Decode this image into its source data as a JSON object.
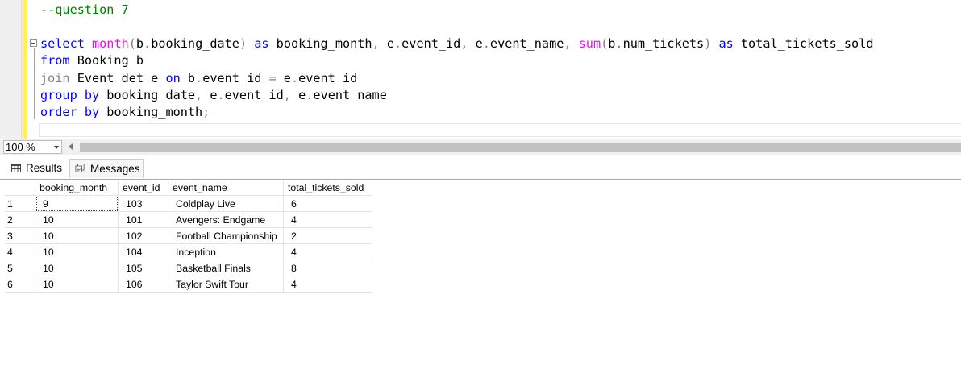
{
  "editor": {
    "lines": [
      [
        {
          "t": "--question 7",
          "c": "cm"
        }
      ],
      [],
      [
        {
          "t": "select ",
          "c": "kw"
        },
        {
          "t": "month",
          "c": "fn"
        },
        {
          "t": "(",
          "c": "op"
        },
        {
          "t": "b",
          "c": ""
        },
        {
          "t": ".",
          "c": "op"
        },
        {
          "t": "booking_date",
          "c": ""
        },
        {
          "t": ") ",
          "c": "op"
        },
        {
          "t": "as ",
          "c": "kw"
        },
        {
          "t": "booking_month",
          "c": ""
        },
        {
          "t": ", ",
          "c": "op"
        },
        {
          "t": "e",
          "c": ""
        },
        {
          "t": ".",
          "c": "op"
        },
        {
          "t": "event_id",
          "c": ""
        },
        {
          "t": ", ",
          "c": "op"
        },
        {
          "t": "e",
          "c": ""
        },
        {
          "t": ".",
          "c": "op"
        },
        {
          "t": "event_name",
          "c": ""
        },
        {
          "t": ", ",
          "c": "op"
        },
        {
          "t": "sum",
          "c": "fn"
        },
        {
          "t": "(",
          "c": "op"
        },
        {
          "t": "b",
          "c": ""
        },
        {
          "t": ".",
          "c": "op"
        },
        {
          "t": "num_tickets",
          "c": ""
        },
        {
          "t": ") ",
          "c": "op"
        },
        {
          "t": "as ",
          "c": "kw"
        },
        {
          "t": "total_tickets_sold",
          "c": ""
        }
      ],
      [
        {
          "t": "from ",
          "c": "kw"
        },
        {
          "t": "Booking b",
          "c": ""
        }
      ],
      [
        {
          "t": "join ",
          "c": "op"
        },
        {
          "t": "Event_det e ",
          "c": ""
        },
        {
          "t": "on ",
          "c": "kw"
        },
        {
          "t": "b",
          "c": ""
        },
        {
          "t": ".",
          "c": "op"
        },
        {
          "t": "event_id ",
          "c": ""
        },
        {
          "t": "= ",
          "c": "op"
        },
        {
          "t": "e",
          "c": ""
        },
        {
          "t": ".",
          "c": "op"
        },
        {
          "t": "event_id",
          "c": ""
        }
      ],
      [
        {
          "t": "group by ",
          "c": "kw"
        },
        {
          "t": "booking_date",
          "c": ""
        },
        {
          "t": ", ",
          "c": "op"
        },
        {
          "t": "e",
          "c": ""
        },
        {
          "t": ".",
          "c": "op"
        },
        {
          "t": "event_id",
          "c": ""
        },
        {
          "t": ", ",
          "c": "op"
        },
        {
          "t": "e",
          "c": ""
        },
        {
          "t": ".",
          "c": "op"
        },
        {
          "t": "event_name",
          "c": ""
        }
      ],
      [
        {
          "t": "order by ",
          "c": "kw"
        },
        {
          "t": "booking_month",
          "c": ""
        },
        {
          "t": ";",
          "c": "op"
        }
      ]
    ]
  },
  "zoom": {
    "value": "100 %"
  },
  "tabs": {
    "results": "Results",
    "messages": "Messages"
  },
  "grid": {
    "columns": [
      "booking_month",
      "event_id",
      "event_name",
      "total_tickets_sold"
    ],
    "rows": [
      [
        "1",
        "9",
        "103",
        "Coldplay Live",
        "6"
      ],
      [
        "2",
        "10",
        "101",
        "Avengers: Endgame",
        "4"
      ],
      [
        "3",
        "10",
        "102",
        "Football Championship",
        "2"
      ],
      [
        "4",
        "10",
        "104",
        "Inception",
        "4"
      ],
      [
        "5",
        "10",
        "105",
        "Basketball Finals",
        "8"
      ],
      [
        "6",
        "10",
        "106",
        "Taylor Swift Tour",
        "4"
      ]
    ]
  }
}
